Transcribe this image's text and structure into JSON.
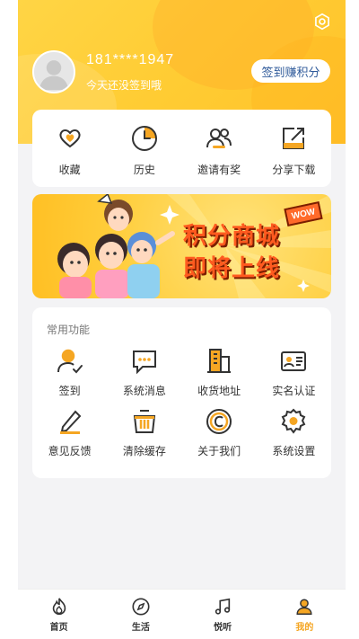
{
  "header": {
    "phone": "181****1947",
    "subtitle": "今天还没签到哦",
    "signin_button": "签到赚积分",
    "settings_icon": "settings-icon"
  },
  "quick_actions": [
    {
      "label": "收藏",
      "icon": "heart-icon"
    },
    {
      "label": "历史",
      "icon": "clock-icon"
    },
    {
      "label": "邀请有奖",
      "icon": "users-icon"
    },
    {
      "label": "分享下载",
      "icon": "share-icon"
    }
  ],
  "banner": {
    "line1": "积分商城",
    "line2": "即将上线",
    "badge": "WOW"
  },
  "functions": {
    "title": "常用功能",
    "items": [
      {
        "label": "签到",
        "icon": "user-check-icon"
      },
      {
        "label": "系统消息",
        "icon": "message-icon"
      },
      {
        "label": "收货地址",
        "icon": "building-icon"
      },
      {
        "label": "实名认证",
        "icon": "id-card-icon"
      },
      {
        "label": "意见反馈",
        "icon": "pencil-icon"
      },
      {
        "label": "清除缓存",
        "icon": "basket-icon"
      },
      {
        "label": "关于我们",
        "icon": "copyright-icon"
      },
      {
        "label": "系统设置",
        "icon": "gear-icon"
      }
    ]
  },
  "tabbar": [
    {
      "label": "首页",
      "icon": "flame-icon",
      "active": false
    },
    {
      "label": "生活",
      "icon": "compass-icon",
      "active": false
    },
    {
      "label": "悦听",
      "icon": "music-icon",
      "active": false
    },
    {
      "label": "我的",
      "icon": "profile-icon",
      "active": true
    }
  ],
  "colors": {
    "accent": "#f5a623",
    "header_yellow": "#ffcc33",
    "signin_text": "#2f5a9a"
  }
}
